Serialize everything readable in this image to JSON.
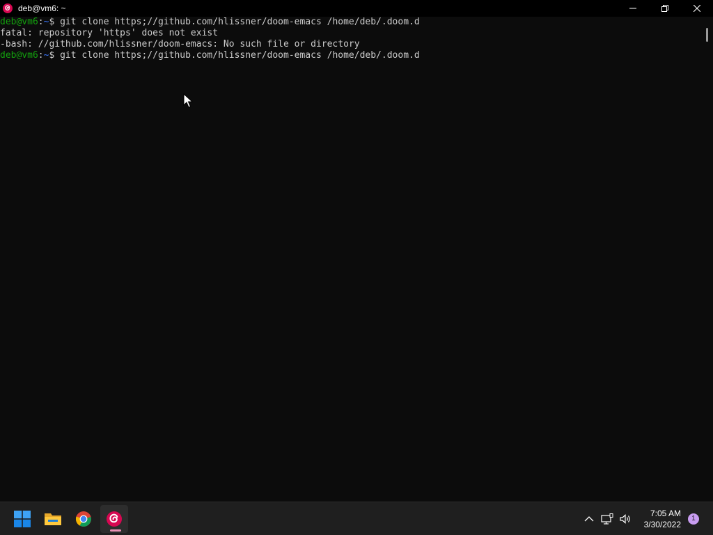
{
  "window": {
    "title": "deb@vm6: ~",
    "icon": "debian-swirl-icon"
  },
  "colors": {
    "terminal_bg": "#0c0c0c",
    "terminal_fg": "#cccccc",
    "prompt_user": "#13a10e",
    "prompt_path": "#3b78ff",
    "debian_red": "#d70751",
    "taskbar_bg": "#1f1f1f"
  },
  "terminal": {
    "lines": [
      {
        "type": "prompt",
        "user": "deb@vm6",
        "sep": ":",
        "path": "~",
        "sign": "$ ",
        "command": "git clone https;//github.com/hlissner/doom-emacs /home/deb/.doom.d"
      },
      {
        "type": "output",
        "text": "fatal: repository 'https' does not exist"
      },
      {
        "type": "output",
        "text": "-bash: //github.com/hlissner/doom-emacs: No such file or directory"
      },
      {
        "type": "prompt",
        "user": "deb@vm6",
        "sep": ":",
        "path": "~",
        "sign": "$ ",
        "command": "git clone https;//github.com/hlissner/doom-emacs /home/deb/.doom.d"
      }
    ]
  },
  "taskbar": {
    "apps": [
      {
        "name": "start-button",
        "icon": "windows-logo-icon"
      },
      {
        "name": "file-explorer",
        "icon": "folder-icon"
      },
      {
        "name": "chrome",
        "icon": "chrome-icon"
      },
      {
        "name": "debian-terminal",
        "icon": "debian-swirl-icon",
        "active": true
      }
    ],
    "tray": {
      "clock_time": "7:05 AM",
      "clock_date": "3/30/2022",
      "notification_count": "1"
    }
  }
}
